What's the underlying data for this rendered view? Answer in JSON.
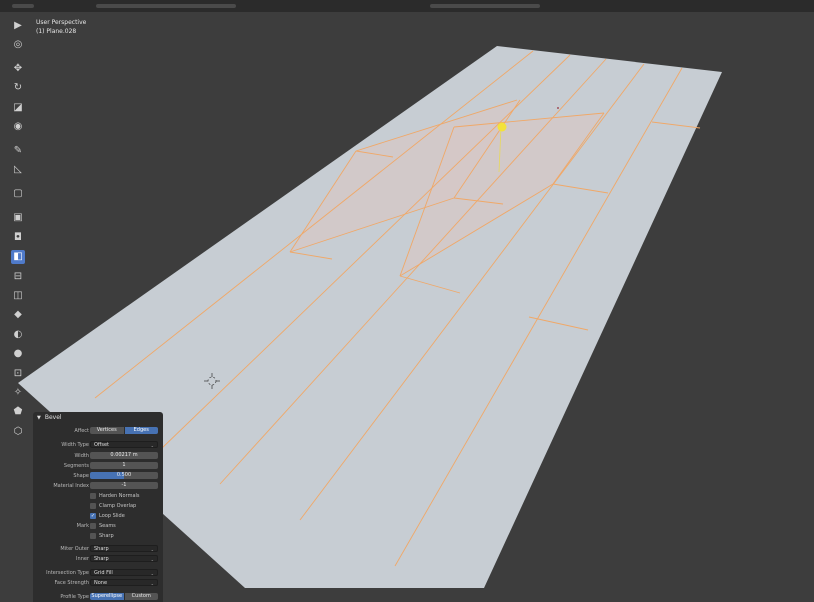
{
  "viewport": {
    "perspective": "User Perspective",
    "object": "(1) Plane.028"
  },
  "toolbar": {
    "tools": [
      "select-box",
      "cursor",
      "move",
      "rotate",
      "scale",
      "transform",
      "annotate",
      "measure",
      "add-cube",
      "extrude-region",
      "inset-faces",
      "bevel",
      "loop-cut",
      "knife",
      "poly-build",
      "spin",
      "smooth",
      "edge-slide",
      "shrink-fatten",
      "shear",
      "rip-region"
    ],
    "active_tool": "bevel"
  },
  "bevel_panel": {
    "title": "Bevel",
    "affect_label": "Affect",
    "affect_options": [
      "Vertices",
      "Edges"
    ],
    "affect_selected": "Edges",
    "width_type_label": "Width Type",
    "width_type_value": "Offset",
    "width_label": "Width",
    "width_value": "0.00217 m",
    "segments_label": "Segments",
    "segments_value": "1",
    "shape_label": "Shape",
    "shape_value": "0.500",
    "shape_fraction": 0.5,
    "material_index_label": "Material Index",
    "material_index_value": "-1",
    "harden_normals_label": "Harden Normals",
    "harden_normals": false,
    "clamp_overlap_label": "Clamp Overlap",
    "clamp_overlap": false,
    "loop_slide_label": "Loop Slide",
    "loop_slide": true,
    "mark_label": "Mark",
    "seams_label": "Seams",
    "seams": false,
    "sharp_label": "Sharp",
    "sharp": false,
    "miter_outer_label": "Miter Outer",
    "miter_outer_value": "Sharp",
    "inner_label": "Inner",
    "inner_value": "Sharp",
    "intersection_type_label": "Intersection Type",
    "intersection_type_value": "Grid Fill",
    "face_strength_label": "Face Strength",
    "face_strength_value": "None",
    "profile_type_label": "Profile Type",
    "profile_type_options": [
      "Superellipse",
      "Custom"
    ],
    "profile_type_selected": "Superellipse"
  },
  "colors": {
    "viewport_bg": "#3d3d3d",
    "plane_face": "#c7cdd3",
    "selected_face": "#d6c7c5",
    "edge_highlight": "#f0a868",
    "light_gizmo": "#f3e23a",
    "accent_blue": "#4772b3"
  }
}
